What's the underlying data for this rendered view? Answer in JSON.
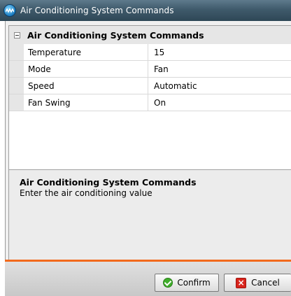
{
  "window": {
    "title": "Air Conditioning System Commands",
    "app_icon": "app-logo-icon"
  },
  "grid": {
    "category": "Air Conditioning System Commands",
    "rows": [
      {
        "name": "Temperature",
        "value": "15"
      },
      {
        "name": "Mode",
        "value": "Fan"
      },
      {
        "name": "Speed",
        "value": "Automatic"
      },
      {
        "name": "Fan Swing",
        "value": "On"
      }
    ]
  },
  "description": {
    "title": "Air Conditioning System Commands",
    "text": "Enter the air conditioning value"
  },
  "footer": {
    "confirm_label": "Confirm",
    "cancel_label": "Cancel",
    "accent_color": "#f26a1c"
  }
}
